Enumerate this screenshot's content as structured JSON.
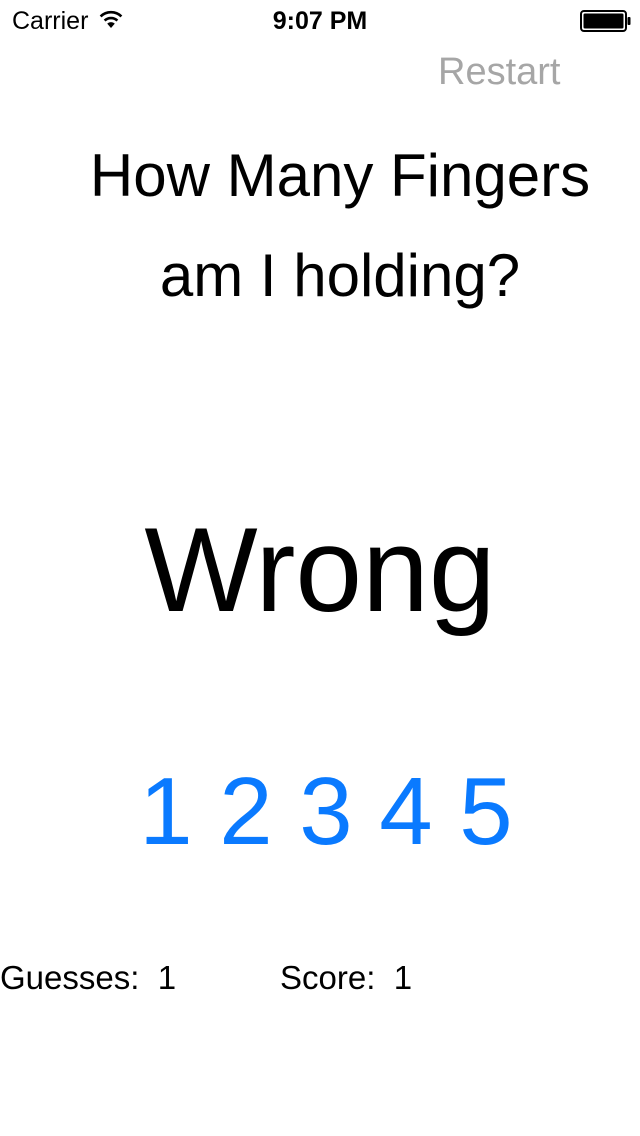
{
  "status_bar": {
    "carrier": "Carrier",
    "time": "9:07 PM",
    "wifi_icon": "wifi-icon",
    "battery_icon": "battery-icon"
  },
  "header": {
    "restart_label": "Restart"
  },
  "title": {
    "line1": "How Many Fingers",
    "line2": "am I holding?"
  },
  "result": {
    "text": "Wrong"
  },
  "choices": [
    "1",
    "2",
    "3",
    "4",
    "5"
  ],
  "stats": {
    "guesses_label": "Guesses:",
    "guesses_value": "1",
    "score_label": "Score:",
    "score_value": "1"
  },
  "colors": {
    "accent": "#0a7aff",
    "restart": "#a6a6a6",
    "text": "#000000",
    "background": "#ffffff"
  }
}
